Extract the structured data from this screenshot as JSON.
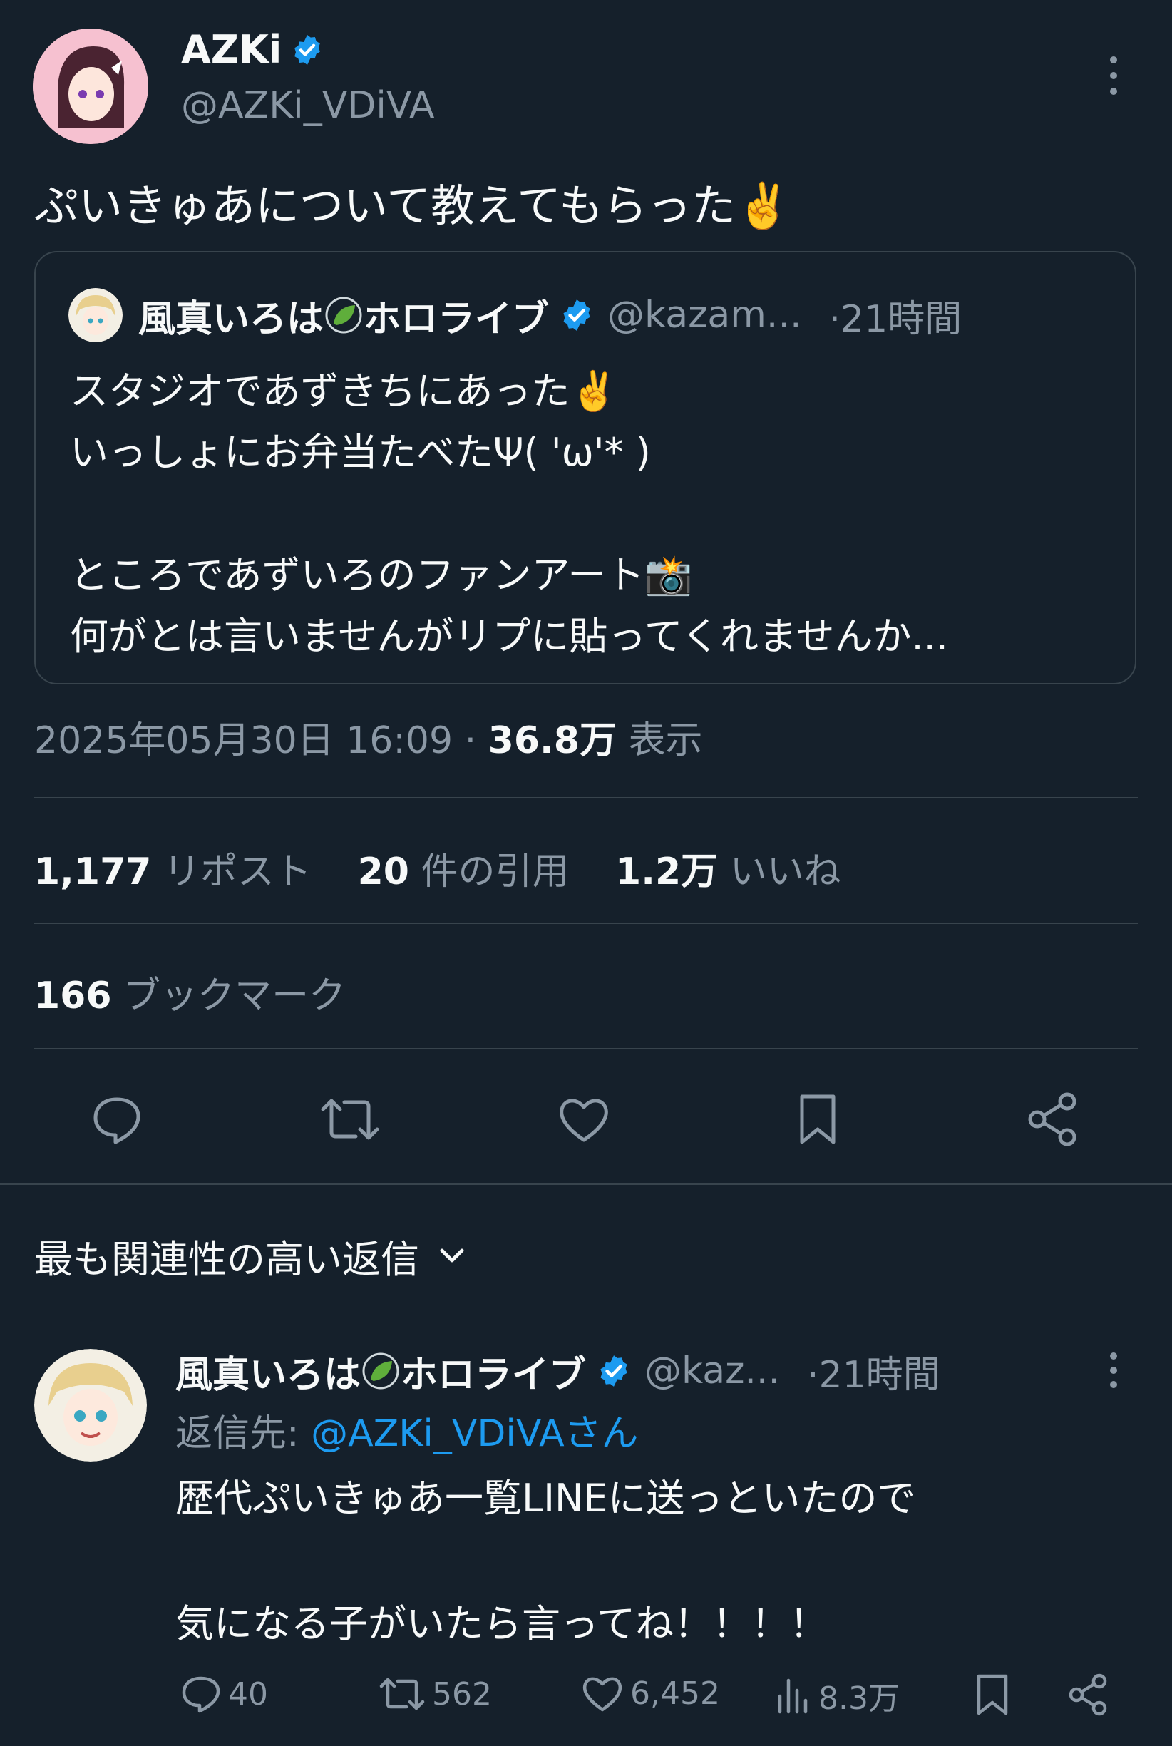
{
  "tweet": {
    "author_name": "AZKi",
    "author_handle": "@AZKi_VDiVA",
    "text": "ぷいきゅあについて教えてもらった",
    "text_emoji": "✌️",
    "timestamp": "2025年05月30日 16:09",
    "sep": "·",
    "views_count": "36.8万",
    "views_label": "表示"
  },
  "quote": {
    "author_name": "風真いろは",
    "author_name_suffix": "ホロライブ",
    "author_handle": "@kazam...",
    "time": "·21時間",
    "line1": "スタジオであずきちにあった",
    "line1_emoji": "✌️",
    "line2": "いっしょにお弁当たべたΨ( 'ω'* )",
    "line3": "ところであずいろのファンアート",
    "line3_emoji": "📸",
    "line4": "何がとは言いませんがリプに貼ってくれませんか..."
  },
  "stats": {
    "reposts_count": "1,177",
    "reposts_label": "リポスト",
    "quotes_count": "20",
    "quotes_label": "件の引用",
    "likes_count": "1.2万",
    "likes_label": "いいね",
    "bookmarks_count": "166",
    "bookmarks_label": "ブックマーク"
  },
  "actions": [
    "reply-icon",
    "retweet-icon",
    "heart-icon",
    "bookmark-icon",
    "share-icon"
  ],
  "replies_header": {
    "label": "最も関連性の高い返信",
    "icon": "chevron-down-icon"
  },
  "reply": {
    "author_name": "風真いろは",
    "author_name_suffix": "ホロライブ",
    "author_handle": "@kaz...",
    "time": "·21時間",
    "reply_to_prefix": "返信先: ",
    "reply_to_user": "@AZKi_VDiVAさん",
    "line1": "歴代ぷいきゅあ一覧LINEに送っといたので",
    "line2": "気になる子がいたら言ってね！！！！",
    "replies": "40",
    "retweets": "562",
    "likes": "6,452",
    "views": "8.3万"
  },
  "colors": {
    "background": "#15202b",
    "text": "#f7f9f9",
    "muted": "#8b98a5",
    "accent": "#1d9bf0",
    "divider": "#38444d"
  }
}
